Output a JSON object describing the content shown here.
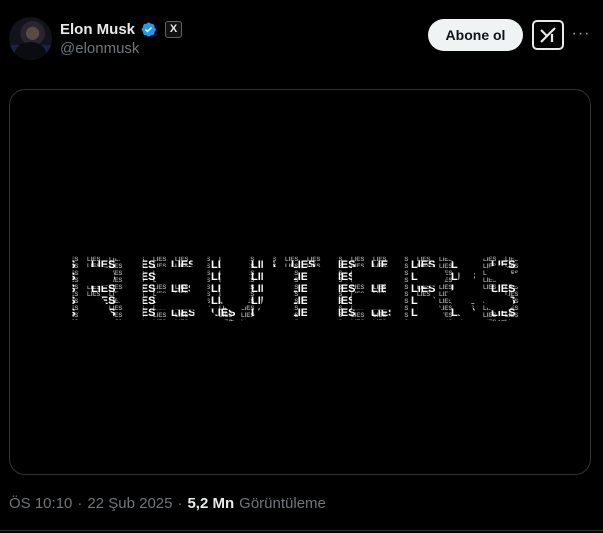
{
  "author": {
    "display_name": "Elon Musk",
    "handle": "@elonmusk",
    "avatar_icon": "avatar-photo",
    "verified_icon": "verified-badge-icon",
    "affiliate_icon": "x-logo-icon",
    "affiliate_letter": "X"
  },
  "actions": {
    "follow_label": "Abone ol",
    "grok_icon": "grok-icon",
    "more_icon": "more-icon",
    "more_glyph": "···"
  },
  "media": {
    "filler_word": "LIES"
  },
  "meta": {
    "time": "ÖS 10:10",
    "separator": "·",
    "date": "22 Şub 2025",
    "views_count": "5,2 Mn",
    "views_label": "Görüntüleme"
  },
  "colors": {
    "background": "#000000",
    "text_primary": "#e7e9ea",
    "text_secondary": "#71767b",
    "verified": "#1d9bf0",
    "border": "#2f3336"
  }
}
